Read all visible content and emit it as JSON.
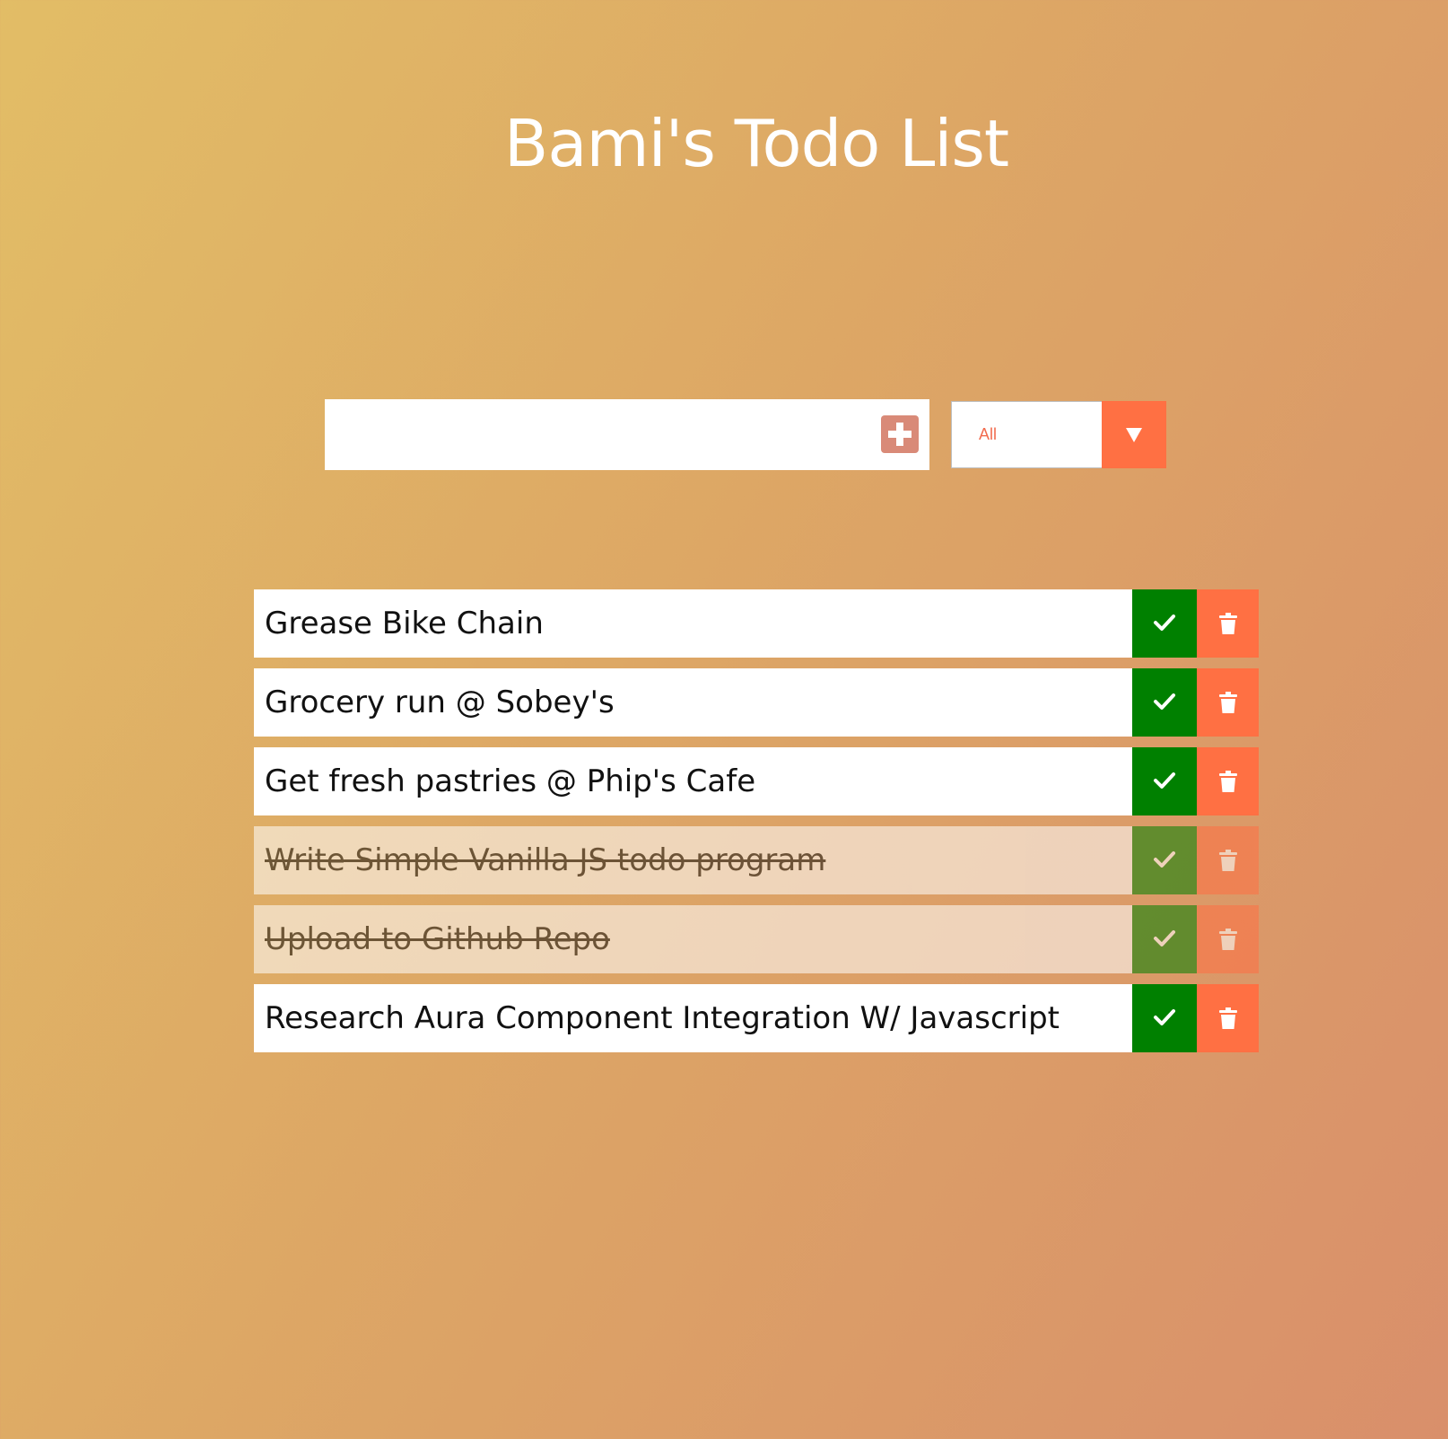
{
  "header": {
    "title": "Bami's Todo List"
  },
  "input": {
    "value": "",
    "placeholder": "",
    "add_icon": "plus-square-icon"
  },
  "filter": {
    "selected": "All",
    "arrow_icon": "caret-down-icon"
  },
  "todos": [
    {
      "text": "Grease Bike Chain",
      "completed": false
    },
    {
      "text": "Grocery run @ Sobey's",
      "completed": false
    },
    {
      "text": "Get fresh pastries @ Phip's Cafe",
      "completed": false
    },
    {
      "text": "Write Simple Vanilla JS todo program",
      "completed": true
    },
    {
      "text": "Upload to Github Repo",
      "completed": true
    },
    {
      "text": "Research Aura Component Integration W/ Javascript",
      "completed": false
    }
  ],
  "icons": {
    "check": "check-icon",
    "trash": "trash-icon"
  },
  "colors": {
    "check_button": "#008000",
    "trash_button": "#ff7043",
    "filter_text": "#f26c4f",
    "add_button": "#d98a78"
  }
}
